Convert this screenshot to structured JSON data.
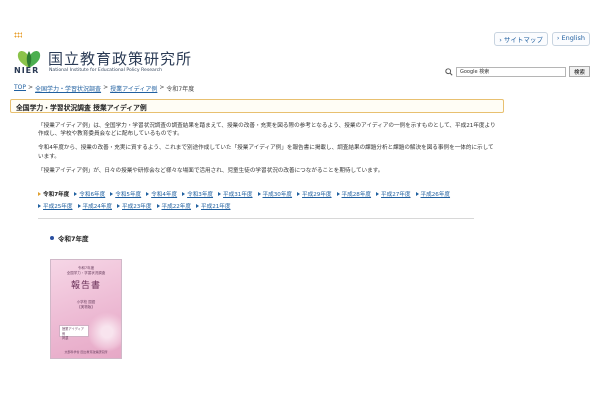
{
  "util_links": [
    "› サイトマップ",
    "› English"
  ],
  "institute": {
    "name_ja": "国立教育政策研究所",
    "abbr": "NIER",
    "name_en": "National Institute for Educational Policy Research"
  },
  "search": {
    "value": "Google 検索",
    "button": "検索"
  },
  "breadcrumb": {
    "items": [
      "TOP",
      "全国学力・学習状況調査",
      "授業アイディア例"
    ],
    "current": "令和7年度",
    "sep": ">"
  },
  "page_title": "全国学力・学習状況調査 授業アイディア例",
  "intro": [
    "「授業アイディア例」は、全国学力・学習状況調査の調査結果を踏まえて、授業の改善・充実を図る際の参考となるよう、授業のアイディアの一例を示すものとして、平成21年度より作成し、学校や教育委員会などに配布しているものです。",
    "令和4年度から、授業の改善・充実に資するよう、これまで別途作成していた「授業アイディア例」を報告書に掲載し、調査結果の課題分析と課題の解決を図る事例を一体的に示しています。",
    "「授業アイディア例」が、日々の授業や研修会など様々な場面で活用され、児童生徒の学習状況の改善につながることを期待しています。"
  ],
  "year_nav": [
    "令和7年度",
    "令和6年度",
    "令和5年度",
    "令和4年度",
    "令和3年度",
    "平成31年度",
    "平成30年度",
    "平成29年度",
    "平成28年度",
    "平成27年度",
    "平成26年度",
    "平成25年度",
    "平成24年度",
    "平成23年度",
    "平成22年度",
    "平成21年度"
  ],
  "year_nav_current_index": 0,
  "section_heading": "令和7年度",
  "cover": {
    "top_line_1": "令和7年度",
    "top_line_2": "全国学力・学習状況調査",
    "title": "報告書",
    "subject_1": "小学校 国語",
    "subject_2": "【実物版】",
    "label_1": "授業アイディア例",
    "label_2": "掲載",
    "org": "文部科学省 国立教育政策研究所"
  },
  "colors": {
    "link": "#2060a0",
    "accent": "#e0a030",
    "title_border": "#e8c070",
    "navy": "#2b3b55"
  }
}
